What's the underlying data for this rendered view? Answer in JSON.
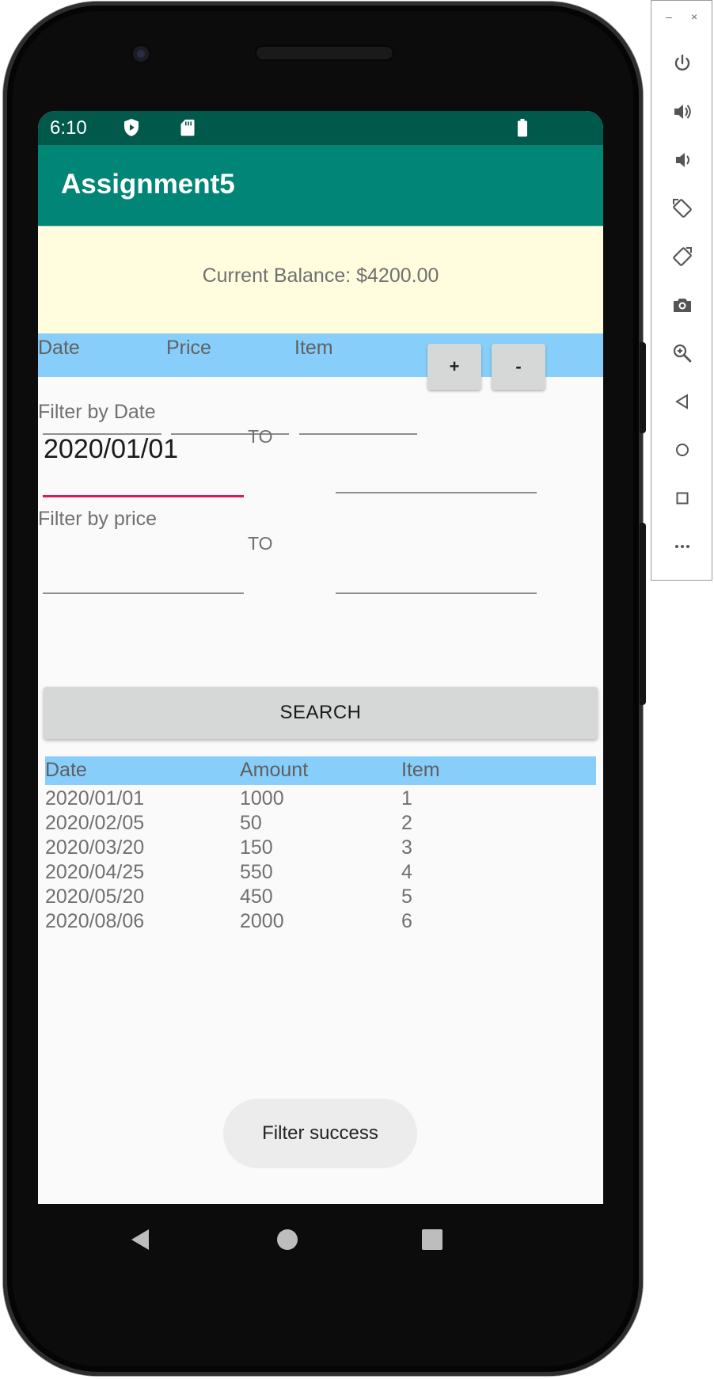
{
  "status_bar": {
    "time": "6:10"
  },
  "app_bar": {
    "title": "Assignment5"
  },
  "balance": {
    "text": "Current Balance: $4200.00"
  },
  "entry_header": {
    "date": "Date",
    "price": "Price",
    "item": "Item"
  },
  "entry_form": {
    "add_label": "+",
    "remove_label": "-"
  },
  "filter_date": {
    "label": "Filter by Date",
    "from_value": "2020/01/01",
    "to_label": "TO",
    "to_value": ""
  },
  "filter_price": {
    "label": "Filter by price",
    "from_value": "",
    "to_label": "TO",
    "to_value": ""
  },
  "search": {
    "label": "SEARCH"
  },
  "results": {
    "columns": [
      "Date",
      "Amount",
      "Item"
    ],
    "rows": [
      [
        "2020/01/01",
        "1000",
        "1"
      ],
      [
        "2020/02/05",
        "50",
        "2"
      ],
      [
        "2020/03/20",
        "150",
        "3"
      ],
      [
        "2020/04/25",
        "550",
        "4"
      ],
      [
        "2020/05/20",
        "450",
        "5"
      ],
      [
        "2020/08/06",
        "2000",
        "6"
      ]
    ]
  },
  "toast": {
    "text": "Filter success"
  },
  "emulator": {
    "window_controls": [
      "–",
      "×"
    ],
    "tools": [
      "power-icon",
      "volume-up-icon",
      "volume-down-icon",
      "rotate-left-icon",
      "rotate-right-icon",
      "camera-icon",
      "zoom-icon",
      "back-icon",
      "home-icon",
      "overview-icon",
      "more-icon"
    ]
  },
  "colors": {
    "status_bar": "#00594b",
    "app_bar": "#008577",
    "balance_bg": "#fffdde",
    "header_bg": "#87cefa",
    "accent": "#d81b60"
  }
}
